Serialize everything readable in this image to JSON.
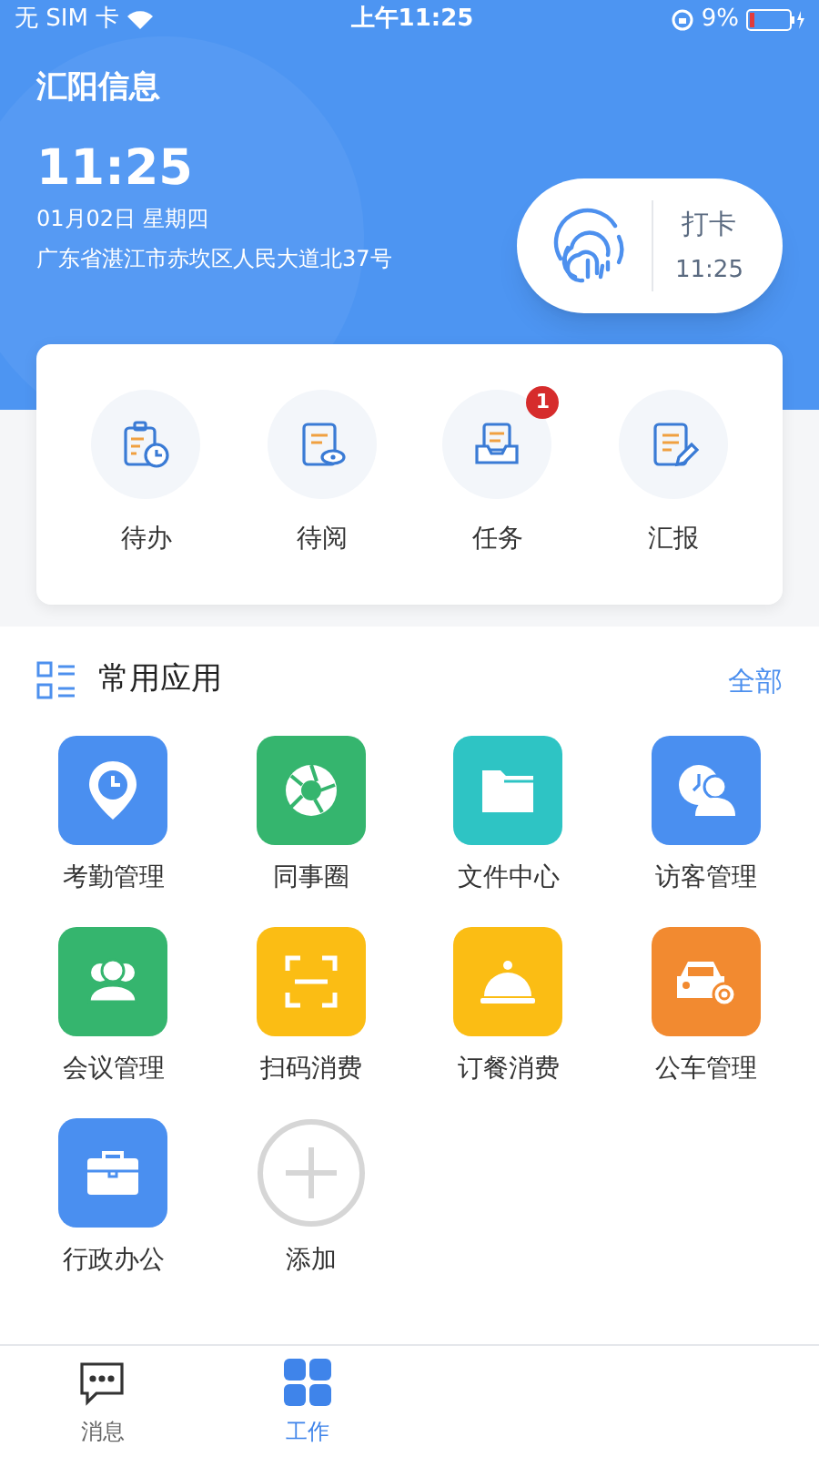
{
  "status_bar": {
    "carrier": "无 SIM 卡",
    "time": "上午11:25",
    "battery": "9%"
  },
  "header": {
    "company": "汇阳信息",
    "time": "11:25",
    "date": "01月02日 星期四",
    "address": "广东省湛江市赤坎区人民大道北37号"
  },
  "punch": {
    "label": "打卡",
    "time": "11:25"
  },
  "shortcuts": [
    {
      "kind": "todo",
      "label": "待办"
    },
    {
      "kind": "read",
      "label": "待阅"
    },
    {
      "kind": "task",
      "label": "任务",
      "badge": "1"
    },
    {
      "kind": "report",
      "label": "汇报"
    }
  ],
  "apps_section": {
    "title": "常用应用",
    "more": "全部"
  },
  "apps": [
    {
      "kind": "attendance",
      "label": "考勤管理",
      "color": "#4a8ff0"
    },
    {
      "kind": "circle",
      "label": "同事圈",
      "color": "#35b56e"
    },
    {
      "kind": "folder",
      "label": "文件中心",
      "color": "#2ec4c4"
    },
    {
      "kind": "visitor",
      "label": "访客管理",
      "color": "#4a8ff0"
    },
    {
      "kind": "meeting",
      "label": "会议管理",
      "color": "#35b56e"
    },
    {
      "kind": "scan",
      "label": "扫码消费",
      "color": "#fbbd14"
    },
    {
      "kind": "meal",
      "label": "订餐消费",
      "color": "#fbbd14"
    },
    {
      "kind": "car",
      "label": "公车管理",
      "color": "#f28a30"
    },
    {
      "kind": "briefcase",
      "label": "行政办公",
      "color": "#4a8ff0"
    },
    {
      "kind": "add",
      "label": "添加"
    }
  ],
  "tabs": [
    {
      "kind": "message",
      "label": "消息",
      "selected": false
    },
    {
      "kind": "work",
      "label": "工作",
      "selected": true
    }
  ]
}
